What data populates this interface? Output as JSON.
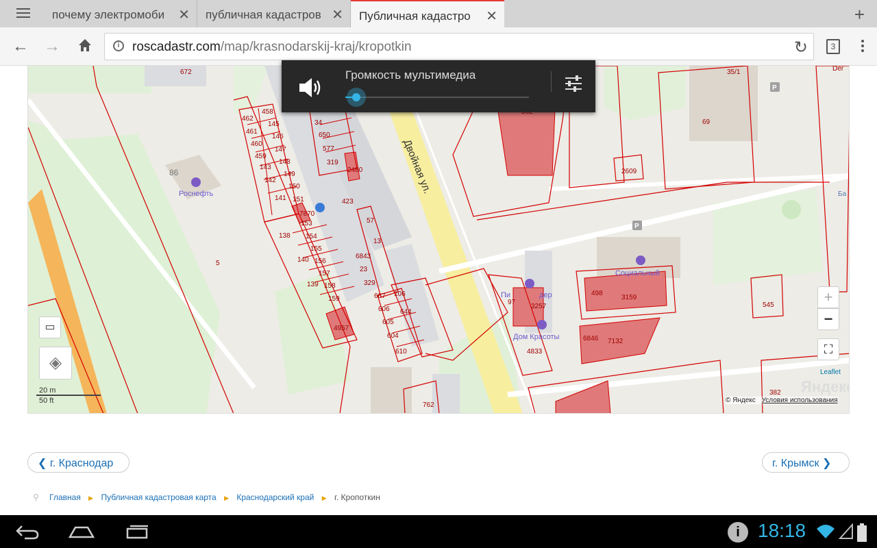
{
  "browser": {
    "tabs": [
      {
        "label": "почему электромоби",
        "active": false
      },
      {
        "label": "публичная кадастров",
        "active": false
      },
      {
        "label": "Публичная кадастро",
        "active": true
      }
    ],
    "url_domain": "roscadastr.com",
    "url_path": "/map/krasnodarskij-kraj/kropotkin",
    "tab_count": "3"
  },
  "volume_popup": {
    "title": "Громкость мультимедиа",
    "level": 0.06
  },
  "map": {
    "street_label": "Двойная ул.",
    "poi": [
      "Роснефть",
      "Социальный",
      "Дом Красоты",
      "Пи",
      "дер"
    ],
    "parcels": [
      "672",
      "458",
      "462",
      "145",
      "461",
      "146",
      "460",
      "147",
      "459",
      "148",
      "143",
      "149",
      "142",
      "150",
      "141",
      "151",
      "7870",
      "153",
      "154",
      "155",
      "140",
      "156",
      "157",
      "139",
      "158",
      "159",
      "4957",
      "138",
      "5",
      "86",
      "34",
      "650",
      "577",
      "319",
      "2480",
      "423",
      "57",
      "13",
      "6843",
      "23",
      "329",
      "667",
      "106",
      "606",
      "644",
      "605",
      "604",
      "610",
      "762",
      "562",
      "69",
      "35/1",
      "2609",
      "498",
      "3159",
      "97",
      "3257",
      "6846",
      "7132",
      "4833",
      "545",
      "382",
      "Der",
      "Ба"
    ],
    "scale_m": "20 m",
    "scale_ft": "50 ft",
    "leaflet": "Leaflet",
    "yandex_logo": "Яндекс",
    "attribution": "© Яндекс",
    "terms": "Условия использования",
    "zoom_in": "+",
    "zoom_out": "−"
  },
  "pager": {
    "prev": "г. Краснодар",
    "next": "г. Крымск"
  },
  "breadcrumb": [
    "Главная",
    "Публичная кадастровая карта",
    "Краснодарский край",
    "г. Кропоткин"
  ],
  "status_bar": {
    "time": "18:18"
  }
}
